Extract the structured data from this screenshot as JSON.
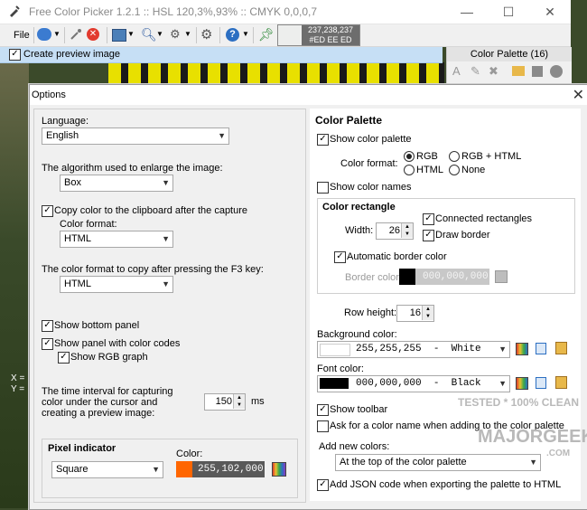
{
  "window": {
    "title": "Free Color Picker 1.2.1  ::  HSL 120,3%,93%  ::  CMYK 0,0,0,7",
    "controls": {
      "minimize": "—",
      "maximize": "☐",
      "close": "✕"
    }
  },
  "toolbar": {
    "file_label": "File",
    "current_color": {
      "hex": "#EDEEED",
      "rgb_text": "237,238,237",
      "hex_text": "#ED EE ED"
    }
  },
  "preview_bar": {
    "label": "Create preview image",
    "checked": true
  },
  "palette_panel": {
    "title": "Color Palette (16)"
  },
  "dialog": {
    "title": "Options",
    "close": "✕",
    "left": {
      "language_label": "Language:",
      "language_value": "English",
      "enlarge_label": "The algorithm used to enlarge the image:",
      "enlarge_value": "Box",
      "copy_clipboard_label": "Copy color to the clipboard after the capture",
      "copy_clipboard_checked": true,
      "color_format_label": "Color format:",
      "color_format_value": "HTML",
      "f3_label": "The color format to copy after pressing the F3 key:",
      "f3_value": "HTML",
      "show_bottom_panel_label": "Show bottom panel",
      "show_panel_codes_label": "Show panel with color codes",
      "show_rgb_graph_label": "Show RGB graph",
      "interval_label_1": "The time interval for capturing",
      "interval_label_2": "color under the cursor and",
      "interval_label_3": "creating a preview image:",
      "interval_value": "150",
      "interval_unit": "ms",
      "pixel_indicator_title": "Pixel indicator",
      "pixel_shape_value": "Square",
      "pixel_color_label": "Color:",
      "pixel_color_value": "255,102,000",
      "pixel_color_hex": "#FF6600"
    },
    "right": {
      "section_title": "Color Palette",
      "show_palette_label": "Show color palette",
      "color_format_label": "Color format:",
      "format_options": {
        "rgb": "RGB",
        "rgb_html": "RGB + HTML",
        "html": "HTML",
        "none": "None"
      },
      "format_selected": "RGB",
      "show_names_label": "Show color names",
      "color_rect_title": "Color rectangle",
      "width_label": "Width:",
      "width_value": "26",
      "connected_label": "Connected rectangles",
      "draw_border_label": "Draw border",
      "auto_border_label": "Automatic border color",
      "border_color_label": "Border color:",
      "border_color_value": "000,000,000",
      "row_height_label": "Row height:",
      "row_height_value": "16",
      "bg_color_label": "Background color:",
      "bg_color_value": "255,255,255  -  White",
      "bg_color_hex": "#FFFFFF",
      "font_color_label": "Font color:",
      "font_color_value": "000,000,000  -  Black",
      "font_color_hex": "#000000",
      "show_toolbar_label": "Show toolbar",
      "ask_name_label": "Ask for a color name when adding to the color palette",
      "add_new_label": "Add new colors:",
      "add_new_value": "At the top of the color palette",
      "json_label": "Add JSON code when exporting the palette to HTML"
    }
  },
  "watermark": {
    "line1": "TESTED * 100% CLEAN",
    "line2": "MAJORGEEKS",
    "line3": ".COM"
  },
  "background_labels": {
    "x": "X =",
    "y": "Y ="
  }
}
